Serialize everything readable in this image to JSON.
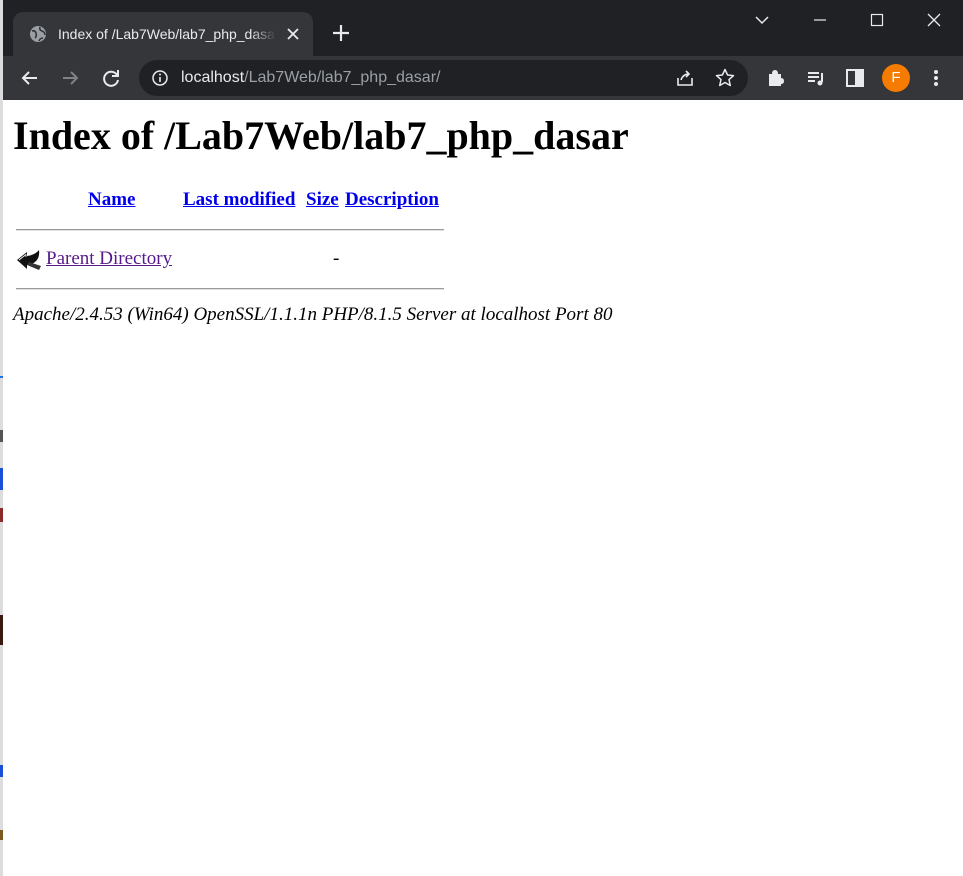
{
  "browser": {
    "tab": {
      "title": "Index of /Lab7Web/lab7_php_dasar/"
    },
    "omnibox": {
      "host": "localhost",
      "path": "/Lab7Web/lab7_php_dasar/"
    },
    "profile": {
      "initial": "F",
      "color": "#f57c00"
    },
    "icons": [
      "globe-icon",
      "close-icon",
      "plus-icon",
      "chevron-down-icon",
      "minimize-icon",
      "maximize-icon",
      "window-close-icon",
      "back-arrow-icon",
      "forward-arrow-icon",
      "reload-icon",
      "info-icon",
      "share-icon",
      "star-icon",
      "extensions-icon",
      "media-icon",
      "side-panel-icon",
      "kebab-menu-icon"
    ]
  },
  "page": {
    "heading": "Index of /Lab7Web/lab7_php_dasar",
    "columns": {
      "name": "Name",
      "last_modified": "Last modified",
      "size": "Size",
      "description": "Description"
    },
    "rows": [
      {
        "icon": "back-icon",
        "name": "Parent Directory",
        "last_modified": "",
        "size": "-",
        "description": ""
      }
    ],
    "server_signature": "Apache/2.4.53 (Win64) OpenSSL/1.1.1n PHP/8.1.5 Server at localhost Port 80",
    "colors": {
      "link": "#0000ee",
      "visited_link": "#551a8b"
    }
  }
}
